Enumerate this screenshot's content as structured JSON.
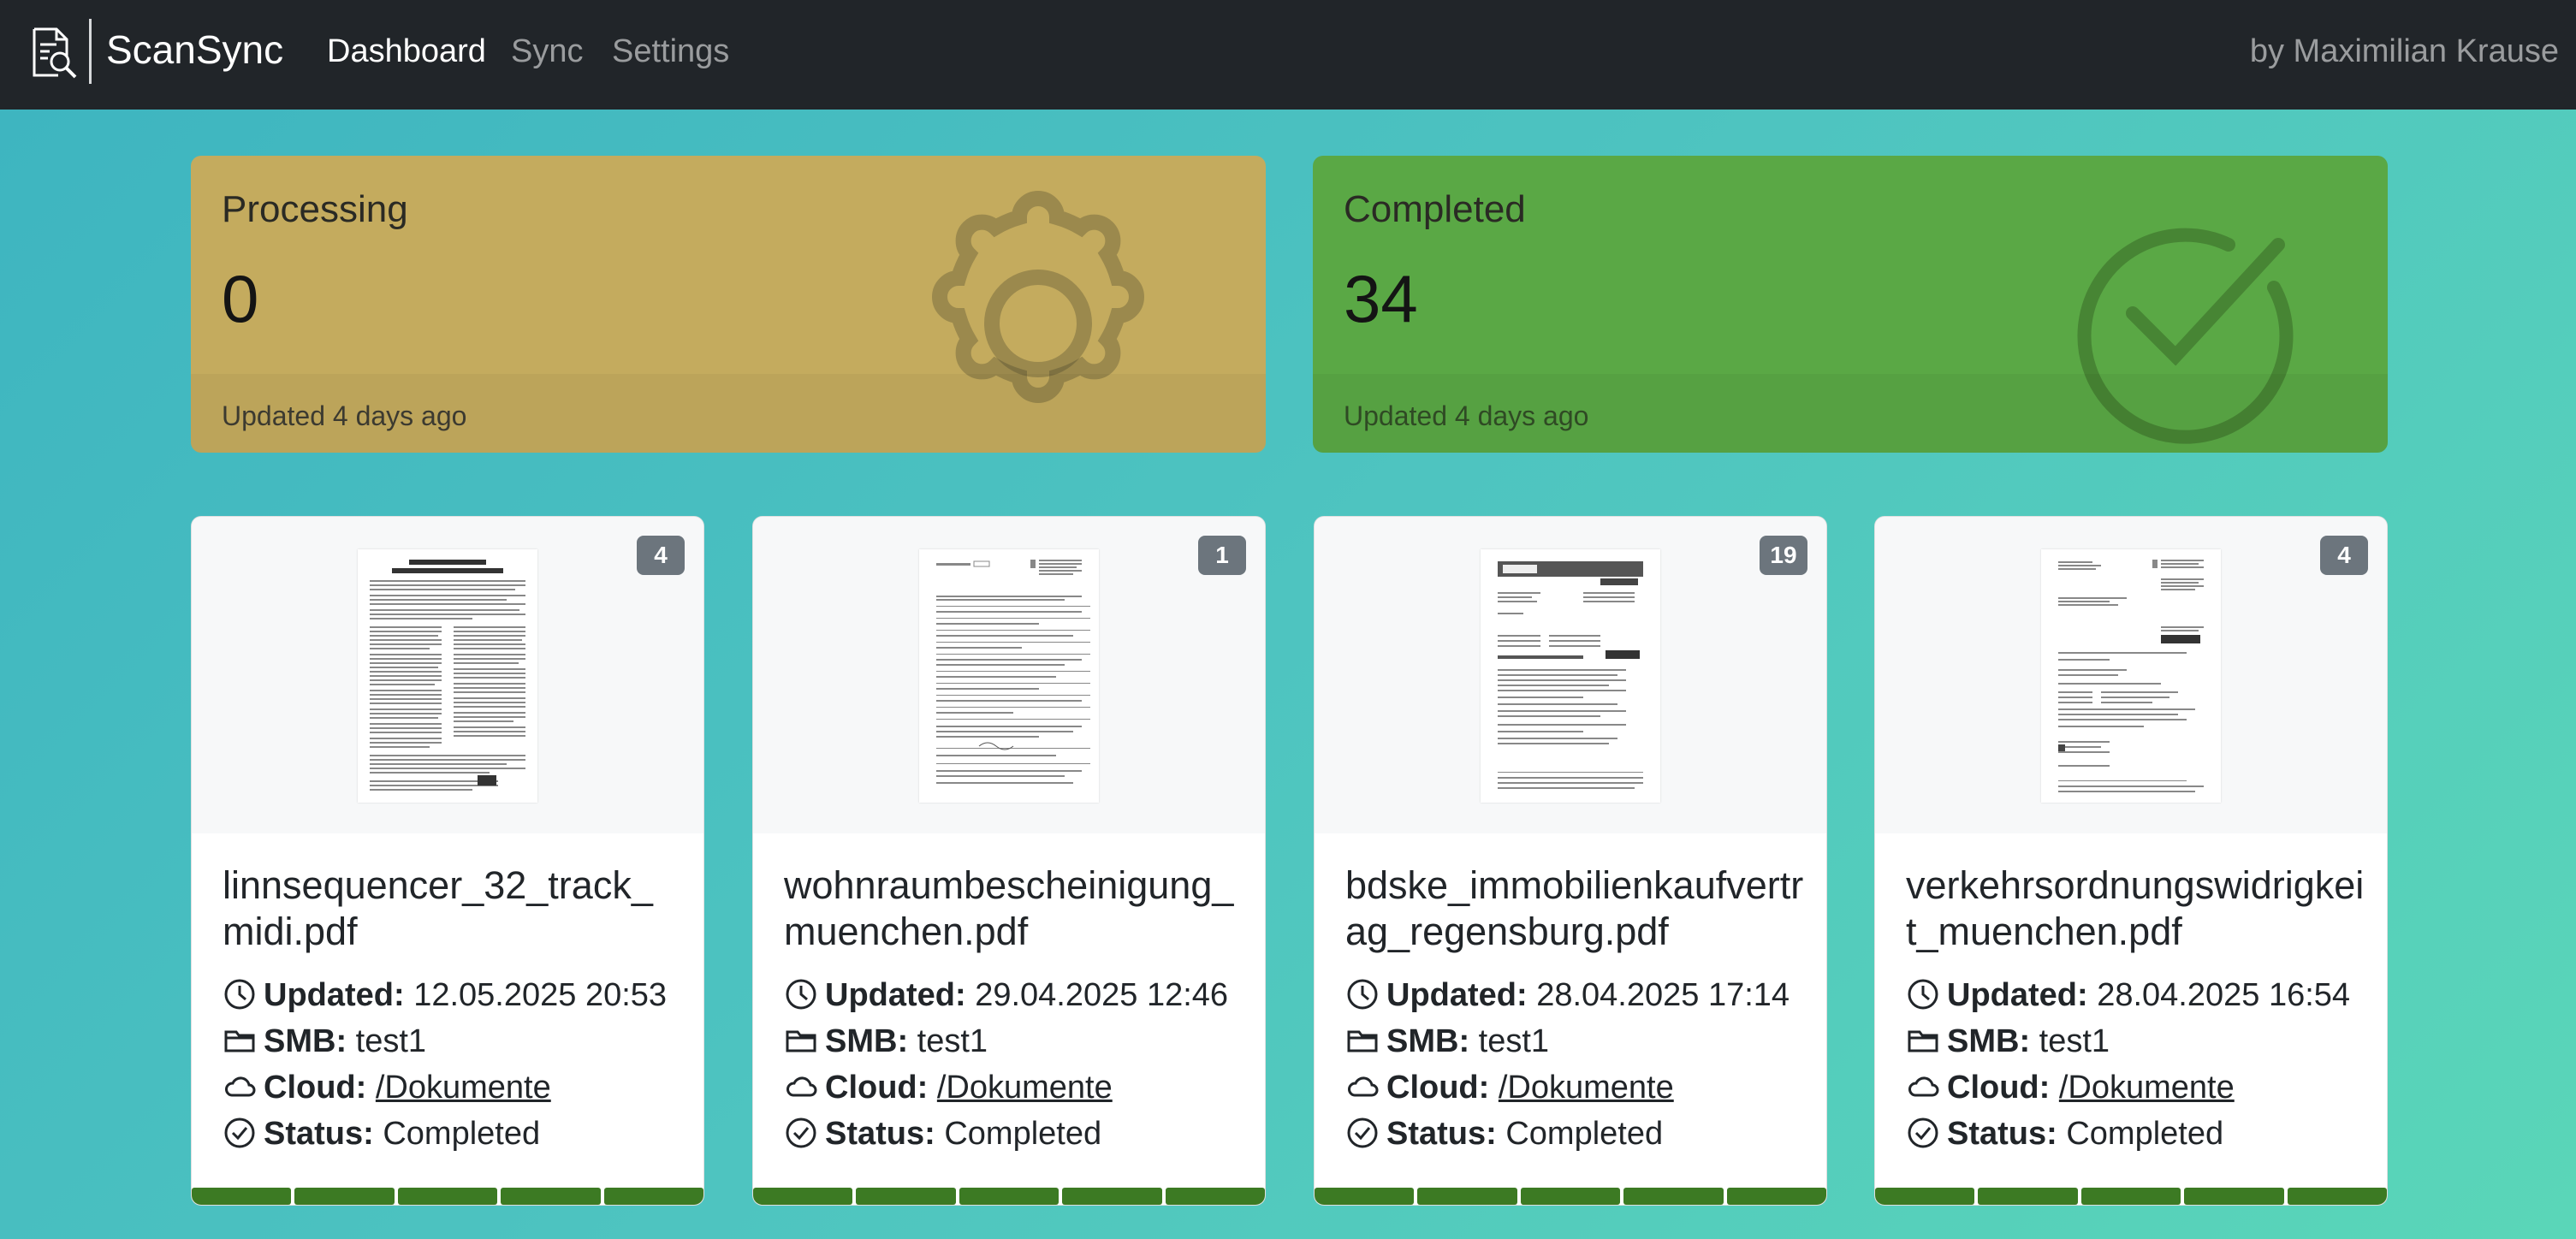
{
  "app": {
    "name": "ScanSync",
    "nav": [
      {
        "label": "Dashboard",
        "active": true
      },
      {
        "label": "Sync",
        "active": false
      },
      {
        "label": "Settings",
        "active": false
      }
    ],
    "author": "by Maximilian Krause"
  },
  "stats": {
    "processing": {
      "title": "Processing",
      "value": "0",
      "updated": "Updated 4 days ago",
      "icon": "gear-icon",
      "color": "#c4ab5e"
    },
    "completed": {
      "title": "Completed",
      "value": "34",
      "updated": "Updated 4 days ago",
      "icon": "check-circle-icon",
      "color": "#5aa845"
    }
  },
  "labels": {
    "updated": "Updated:",
    "smb": "SMB:",
    "cloud": "Cloud:",
    "status": "Status:"
  },
  "documents": [
    {
      "filename": "linnsequencer_32_track_midi.pdf",
      "pages": "4",
      "updated": "12.05.2025 20:53",
      "smb": "test1",
      "cloud": "/Dokumente",
      "status": "Completed",
      "progress": 1.0
    },
    {
      "filename": "wohnraumbescheinigung_muenchen.pdf",
      "pages": "1",
      "updated": "29.04.2025 12:46",
      "smb": "test1",
      "cloud": "/Dokumente",
      "status": "Completed",
      "progress": 1.0
    },
    {
      "filename": "bdske_immobilienkaufvertrag_regensburg.pdf",
      "pages": "19",
      "updated": "28.04.2025 17:14",
      "smb": "test1",
      "cloud": "/Dokumente",
      "status": "Completed",
      "progress": 1.0
    },
    {
      "filename": "verkehrsordnungswidrigkeit_muenchen.pdf",
      "pages": "4",
      "updated": "28.04.2025 16:54",
      "smb": "test1",
      "cloud": "/Dokumente",
      "status": "Completed",
      "progress": 1.0
    }
  ]
}
